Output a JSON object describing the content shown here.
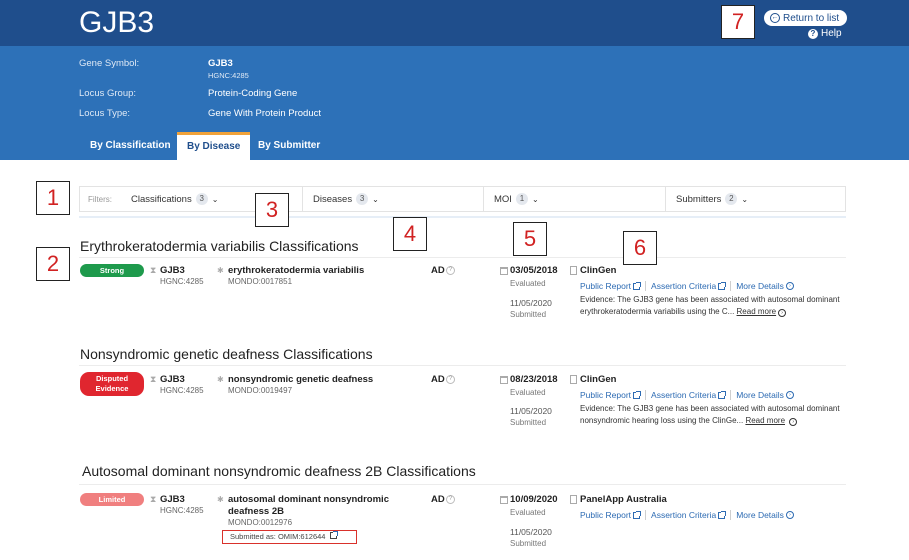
{
  "page": {
    "gene_title": "GJB3",
    "return_label": "Return to list",
    "help_label": "Help"
  },
  "meta": {
    "gene_symbol_label": "Gene Symbol:",
    "gene_symbol_value": "GJB3",
    "hgnc": "HGNC:4285",
    "locus_group_label": "Locus Group:",
    "locus_group_value": "Protein-Coding Gene",
    "locus_type_label": "Locus Type:",
    "locus_type_value": "Gene With Protein Product"
  },
  "tabs": [
    {
      "label": "By Classification",
      "active": false
    },
    {
      "label": "By Disease",
      "active": true
    },
    {
      "label": "By Submitter",
      "active": false
    }
  ],
  "filters": {
    "label": "Filters:",
    "items": [
      {
        "label": "Classifications",
        "count": "3"
      },
      {
        "label": "Diseases",
        "count": "3"
      },
      {
        "label": "MOI",
        "count": "1"
      },
      {
        "label": "Submitters",
        "count": "2"
      }
    ]
  },
  "callouts": [
    "1",
    "2",
    "3",
    "4",
    "5",
    "6",
    "7"
  ],
  "sections": [
    {
      "title": "Erythrokeratodermia variabilis Classifications",
      "badge": "Strong",
      "badge_color": "#1e9a4c",
      "gene": "GJB3",
      "hgnc": "HGNC:4285",
      "disease": "erythrokeratodermia variabilis",
      "mondo": "MONDO:0017851",
      "moi": "AD",
      "evaluated_date": "03/05/2018",
      "evaluated_label": "Evaluated",
      "submitted_date": "11/05/2020",
      "submitted_label": "Submitted",
      "submitter": "ClinGen",
      "links": [
        "Public Report",
        "Assertion Criteria",
        "More Details"
      ],
      "evidence": "Evidence: The GJB3 gene has been associated with autosomal dominant erythrokeratodermia variabilis using the C...",
      "read_more": "Read more"
    },
    {
      "title": "Nonsyndromic genetic deafness Classifications",
      "badge": "Disputed Evidence",
      "badge_line1": "Disputed",
      "badge_line2": "Evidence",
      "badge_color": "#e0262f",
      "gene": "GJB3",
      "hgnc": "HGNC:4285",
      "disease": "nonsyndromic genetic deafness",
      "mondo": "MONDO:0019497",
      "moi": "AD",
      "evaluated_date": "08/23/2018",
      "evaluated_label": "Evaluated",
      "submitted_date": "11/05/2020",
      "submitted_label": "Submitted",
      "submitter": "ClinGen",
      "links": [
        "Public Report",
        "Assertion Criteria",
        "More Details"
      ],
      "evidence": "Evidence: The GJB3 gene has been associated with autosomal dominant nonsyndromic hearing loss using the ClinGe...",
      "read_more": "Read more"
    },
    {
      "title": "Autosomal dominant nonsyndromic deafness 2B Classifications",
      "badge": "Limited",
      "badge_color": "#f07f7f",
      "gene": "GJB3",
      "hgnc": "HGNC:4285",
      "disease_line1": "autosomal dominant nonsyndromic",
      "disease_line2": "deafness 2B",
      "mondo": "MONDO:0012976",
      "submitted_as": "Submitted as: OMIM:612644",
      "moi": "AD",
      "evaluated_date": "10/09/2020",
      "evaluated_label": "Evaluated",
      "submitted_date": "11/05/2020",
      "submitted_label": "Submitted",
      "submitter": "PanelApp Australia",
      "links": [
        "Public Report",
        "Assertion Criteria",
        "More Details"
      ]
    }
  ]
}
